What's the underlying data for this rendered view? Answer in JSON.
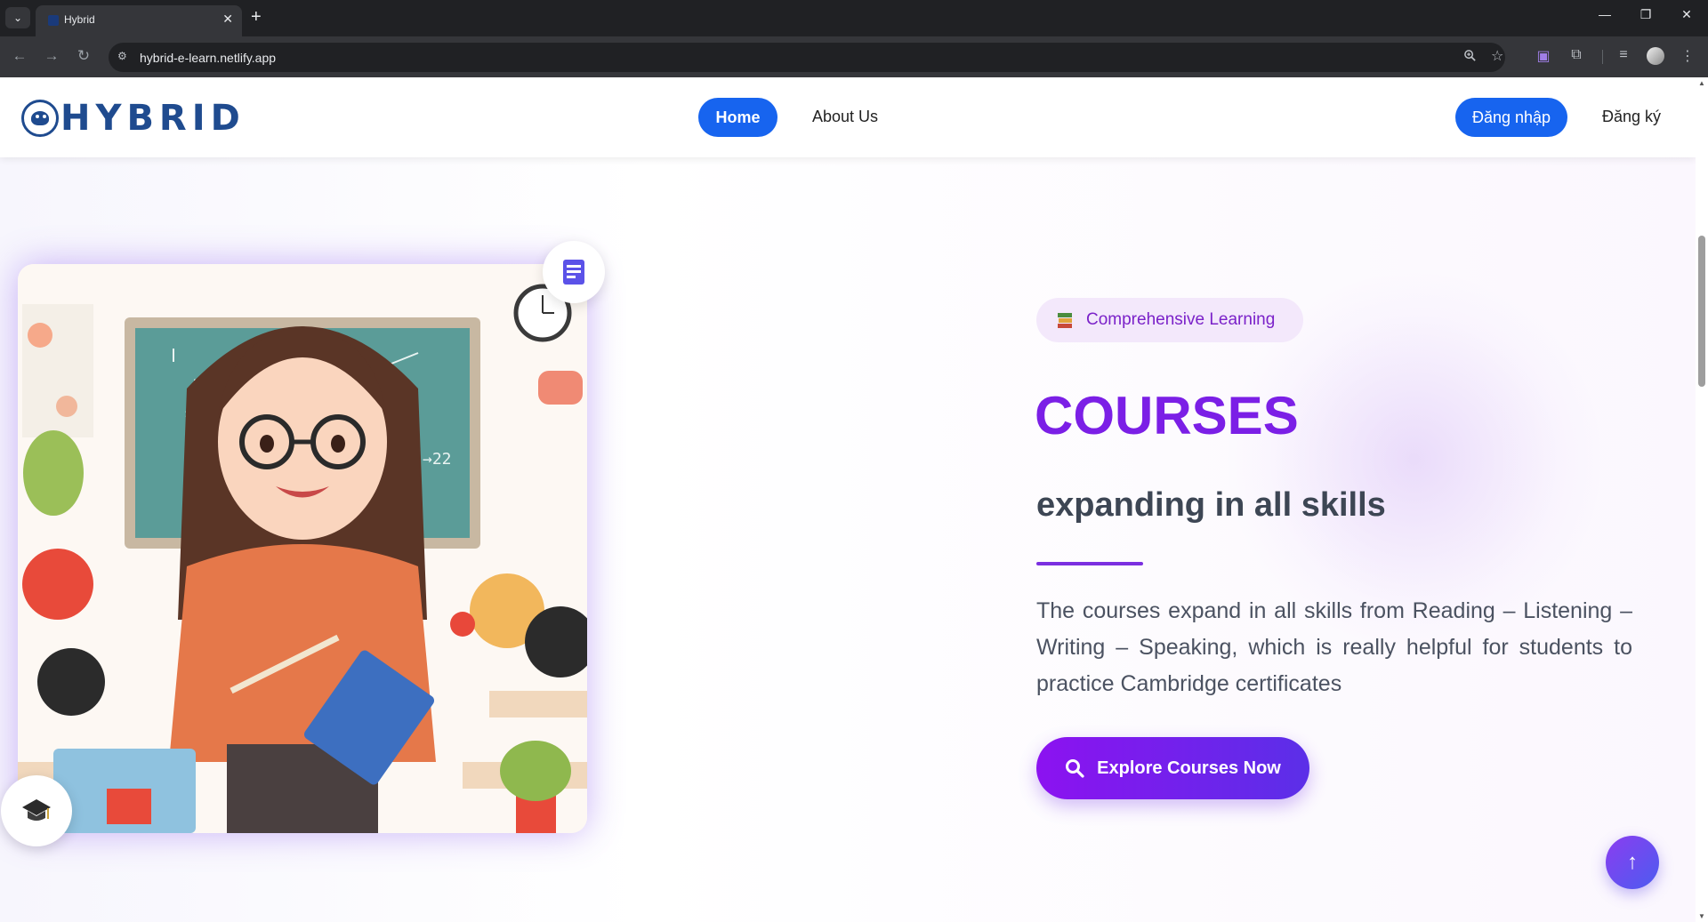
{
  "browser": {
    "tab_title": "Hybrid",
    "tab_close": "✕",
    "new_tab": "+",
    "tab_list": "⌄",
    "url": "hybrid-e-learn.netlify.app",
    "window_controls": {
      "minimize": "—",
      "restore": "❐",
      "close": "✕"
    }
  },
  "header": {
    "logo_text": "HYBRID",
    "nav": {
      "home": "Home",
      "about": "About Us"
    },
    "auth": {
      "login": "Đăng nhập",
      "register": "Đăng ký"
    }
  },
  "hero": {
    "badge_text": "Comprehensive Learning",
    "title": "COURSES",
    "subtitle": "expanding in all skills",
    "description": "The courses expand in all skills from Reading – Listening – Writing – Speaking, which is really helpful for students to practice Cambridge certificates",
    "cta": "Explore Courses Now",
    "scroll_top": "↑"
  },
  "colors": {
    "primary_blue": "#1764ef",
    "accent_purple": "#7b1fe6",
    "logo_navy": "#1f4b8f"
  },
  "icons": [
    "search-icon",
    "book-icon",
    "graduation-cap-icon",
    "arrow-up-icon",
    "zoom-icon",
    "star-icon",
    "extensions-icon"
  ]
}
